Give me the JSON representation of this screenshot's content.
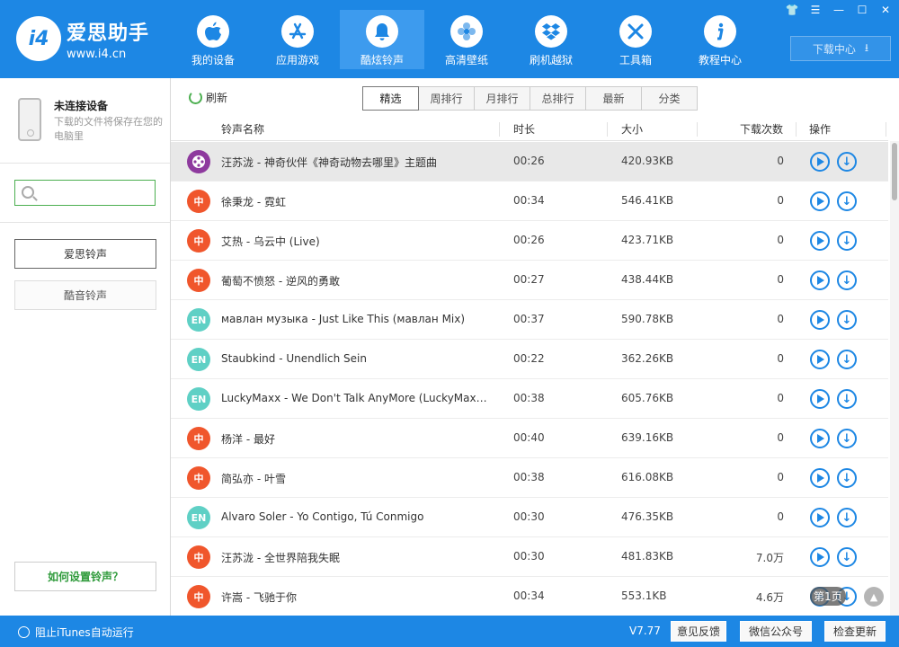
{
  "app": {
    "name": "爱思助手",
    "url": "www.i4.cn",
    "logo_mark": "i4"
  },
  "nav": [
    {
      "label": "我的设备",
      "icon": "apple-icon"
    },
    {
      "label": "应用游戏",
      "icon": "app-store-icon"
    },
    {
      "label": "酷炫铃声",
      "icon": "bell-icon"
    },
    {
      "label": "高清壁纸",
      "icon": "flower-icon"
    },
    {
      "label": "刷机越狱",
      "icon": "dropbox-icon"
    },
    {
      "label": "工具箱",
      "icon": "tools-icon"
    },
    {
      "label": "教程中心",
      "icon": "info-icon"
    }
  ],
  "active_nav": 2,
  "download_center": "下载中心",
  "device": {
    "title": "未连接设备",
    "desc": "下载的文件将保存在您的电脑里"
  },
  "search": {
    "placeholder": "",
    "button": "搜索"
  },
  "categories": [
    "爱思铃声",
    "酷音铃声"
  ],
  "howto": "如何设置铃声？",
  "toolbar": {
    "refresh": "刷新",
    "tabs": [
      "精选",
      "周排行",
      "月排行",
      "总排行",
      "最新",
      "分类"
    ],
    "active_tab": 0
  },
  "table": {
    "headers": [
      "铃声名称",
      "时长",
      "大小",
      "下载次数",
      "操作"
    ],
    "rows": [
      {
        "badge": "",
        "badge_type": "film",
        "name": "汪苏泷 - 神奇伙伴《神奇动物去哪里》主题曲",
        "duration": "00:26",
        "size": "420.93KB",
        "count": "0"
      },
      {
        "badge": "中",
        "badge_type": "zh",
        "name": "徐秉龙 - 霓虹",
        "duration": "00:34",
        "size": "546.41KB",
        "count": "0"
      },
      {
        "badge": "中",
        "badge_type": "zh",
        "name": "艾热 - 乌云中 (Live)",
        "duration": "00:26",
        "size": "423.71KB",
        "count": "0"
      },
      {
        "badge": "中",
        "badge_type": "zh",
        "name": "葡萄不愤怒 - 逆风的勇敢",
        "duration": "00:27",
        "size": "438.44KB",
        "count": "0"
      },
      {
        "badge": "EN",
        "badge_type": "en",
        "name": "мавлан музыка - Just Like This (мавлан Mix)",
        "duration": "00:37",
        "size": "590.78KB",
        "count": "0"
      },
      {
        "badge": "EN",
        "badge_type": "en",
        "name": "Staubkind - Unendlich Sein",
        "duration": "00:22",
        "size": "362.26KB",
        "count": "0"
      },
      {
        "badge": "EN",
        "badge_type": "en",
        "name": "LuckyMaxx - We Don't Talk AnyMore (LuckyMaxx...",
        "duration": "00:38",
        "size": "605.76KB",
        "count": "0"
      },
      {
        "badge": "中",
        "badge_type": "zh",
        "name": "杨洋 - 最好",
        "duration": "00:40",
        "size": "639.16KB",
        "count": "0"
      },
      {
        "badge": "中",
        "badge_type": "zh",
        "name": "简弘亦 - 叶雪",
        "duration": "00:38",
        "size": "616.08KB",
        "count": "0"
      },
      {
        "badge": "EN",
        "badge_type": "en",
        "name": "Alvaro Soler - Yo Contigo, Tú Conmigo",
        "duration": "00:30",
        "size": "476.35KB",
        "count": "0"
      },
      {
        "badge": "中",
        "badge_type": "zh",
        "name": "汪苏泷 - 全世界陪我失眠",
        "duration": "00:30",
        "size": "481.83KB",
        "count": "7.0万"
      },
      {
        "badge": "中",
        "badge_type": "zh",
        "name": "许嵩 - 飞驰于你",
        "duration": "00:34",
        "size": "553.1KB",
        "count": "4.6万"
      }
    ]
  },
  "pager": "第1页",
  "statusbar": {
    "itunes": "阻止iTunes自动运行",
    "version": "V7.77",
    "buttons": [
      "意见反馈",
      "微信公众号",
      "检查更新"
    ]
  },
  "colors": {
    "brand": "#1d87e4",
    "zh_badge": "#f0562c",
    "en_badge": "#5fd0c5",
    "film_badge": "#8e3a9e",
    "search_green": "#4caf50"
  }
}
